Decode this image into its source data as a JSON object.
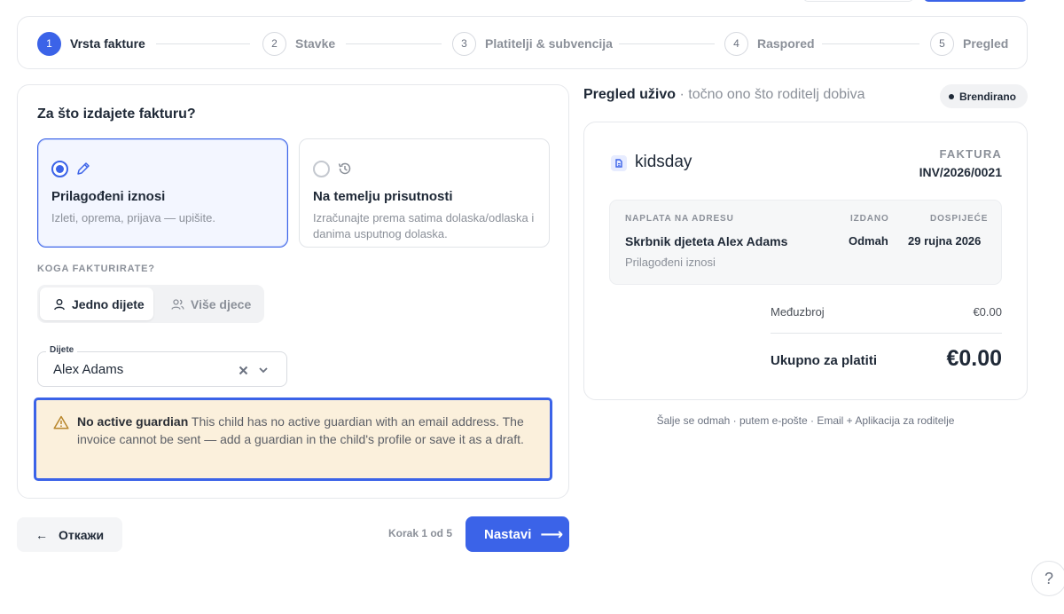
{
  "stepper": {
    "steps": [
      {
        "num": "1",
        "label": "Vrsta fakture"
      },
      {
        "num": "2",
        "label": "Stavke"
      },
      {
        "num": "3",
        "label": "Platitelji & subvencija"
      },
      {
        "num": "4",
        "label": "Raspored"
      },
      {
        "num": "5",
        "label": "Pregled"
      }
    ],
    "active_step": 1
  },
  "form": {
    "question": "Za što izdajete fakturu?",
    "options": [
      {
        "title": "Prilagođeni iznosi",
        "desc": "Izleti, oprema, prijava — upišite.",
        "icon": "pencil-icon",
        "selected": true
      },
      {
        "title": "Na temelju prisutnosti",
        "desc": "Izračunajte prema satima dolaska/odlaska i danima usputnog dolaska.",
        "icon": "clock-history-icon",
        "selected": false
      }
    ],
    "who_label": "KOGA FAKTURIRATE?",
    "segment": [
      {
        "label": "Jedno dijete",
        "icon": "user-icon",
        "active": true
      },
      {
        "label": "Više djece",
        "icon": "users-icon",
        "active": false
      }
    ],
    "child_field": {
      "label": "Dijete",
      "value": "Alex Adams"
    },
    "alert": {
      "title": "No active guardian",
      "text": "This child has no active guardian with an email address. The invoice cannot be sent — add a guardian in the child's profile or save it as a draft."
    }
  },
  "actions": {
    "cancel_label": "Откажи",
    "step_info": "Korak 1 od 5",
    "next_label": "Nastavi"
  },
  "preview": {
    "title": "Pregled uživo",
    "subtitle": " · točno ono što roditelj dobiva",
    "badge": "Brendirano",
    "brand": "kidsday",
    "invoice_label": "FAKTURA",
    "invoice_number": "INV/2026/0021",
    "bill_to_label": "NAPLATA NA ADRESU",
    "bill_to_name": "Skrbnik djeteta Alex Adams",
    "bill_to_sub": "Prilagođeni iznosi",
    "issued_label": "IZDANO",
    "issued_value": "Odmah",
    "due_label": "DOSPIJEĆE",
    "due_value": "29 rujna 2026",
    "subtotal_label": "Međuzbroj",
    "subtotal_value": "€0.00",
    "total_label": "Ukupno za platiti",
    "total_value": "€0.00",
    "footer": "Šalje se odmah · putem e-pošte · Email + Aplikacija za roditelje"
  },
  "help_label": "?",
  "colors": {
    "accent": "#3b63e8",
    "alert_bg": "#fbf0dc",
    "alert_icon": "#b8862b"
  }
}
